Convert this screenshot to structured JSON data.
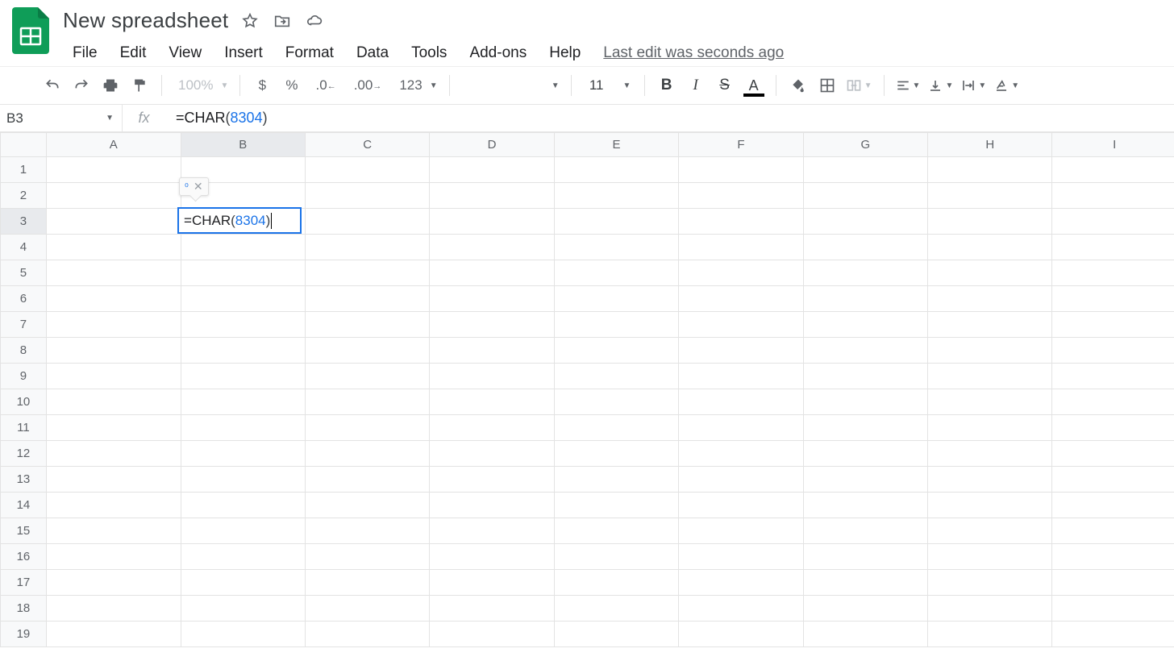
{
  "header": {
    "doc_title": "New spreadsheet",
    "last_edit": "Last edit was seconds ago"
  },
  "menus": [
    "File",
    "Edit",
    "View",
    "Insert",
    "Format",
    "Data",
    "Tools",
    "Add-ons",
    "Help"
  ],
  "toolbar": {
    "zoom": "100%",
    "currency": "$",
    "percent": "%",
    "dec_minus": ".0",
    "dec_plus": ".00",
    "num_format": "123",
    "font_size": "11"
  },
  "name_box": "B3",
  "fx_label": "fx",
  "formula": {
    "eq": "=",
    "fn": "CHAR",
    "open": "(",
    "arg": "8304",
    "close": ")"
  },
  "columns": [
    "A",
    "B",
    "C",
    "D",
    "E",
    "F",
    "G",
    "H",
    "I"
  ],
  "rows": [
    1,
    2,
    3,
    4,
    5,
    6,
    7,
    8,
    9,
    10,
    11,
    12,
    13,
    14,
    15,
    16,
    17,
    18,
    19
  ],
  "preview_tip": {
    "value": "⁰",
    "close": "✕"
  },
  "active_cell": {
    "col": "B",
    "row": 3
  }
}
